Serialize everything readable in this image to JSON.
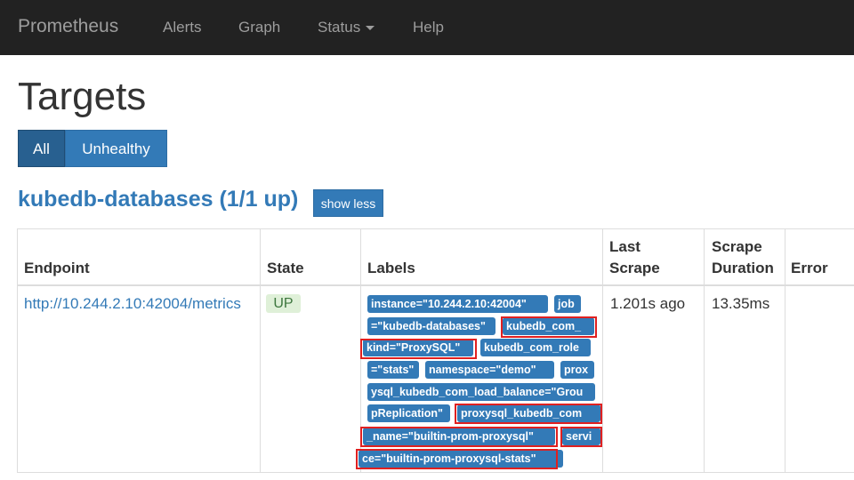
{
  "nav": {
    "brand": "Prometheus",
    "items": [
      "Alerts",
      "Graph",
      "Status",
      "Help"
    ]
  },
  "page": {
    "title": "Targets"
  },
  "filters": {
    "all": "All",
    "unhealthy": "Unhealthy"
  },
  "job": {
    "title": "kubedb-databases (1/1 up)",
    "toggle_label": "show less"
  },
  "table": {
    "headers": {
      "endpoint": "Endpoint",
      "state": "State",
      "labels": "Labels",
      "last_scrape_1": "Last",
      "last_scrape_2": "Scrape",
      "scrape_duration_1": "Scrape",
      "scrape_duration_2": "Duration",
      "error": "Error"
    },
    "row": {
      "endpoint": "http://10.244.2.10:42004/metrics",
      "state": "UP",
      "last_scrape": "1.201s ago",
      "scrape_duration": "13.35ms",
      "error": ""
    }
  },
  "labels_lines": [
    [
      "instance=\"10.244.2.10:42004\"",
      "job"
    ],
    [
      "=\"kubedb-databases\"",
      "kubedb_com_"
    ],
    [
      "kind=\"ProxySQL\"",
      "kubedb_com_role"
    ],
    [
      "=\"stats\"",
      "namespace=\"demo\"",
      "prox"
    ],
    [
      "ysql_kubedb_com_load_balance=\"Grou"
    ],
    [
      "pReplication\"",
      "proxysql_kubedb_com"
    ],
    [
      "_name=\"builtin-prom-proxysql\"",
      "servi"
    ],
    [
      "ce=\"builtin-prom-proxysql-stats\""
    ]
  ],
  "colors": {
    "navbar": "#222222",
    "primary": "#337ab7",
    "active": "#286090",
    "success_bg": "#dff0d8",
    "success_text": "#3c763d",
    "highlight": "#e02020"
  }
}
